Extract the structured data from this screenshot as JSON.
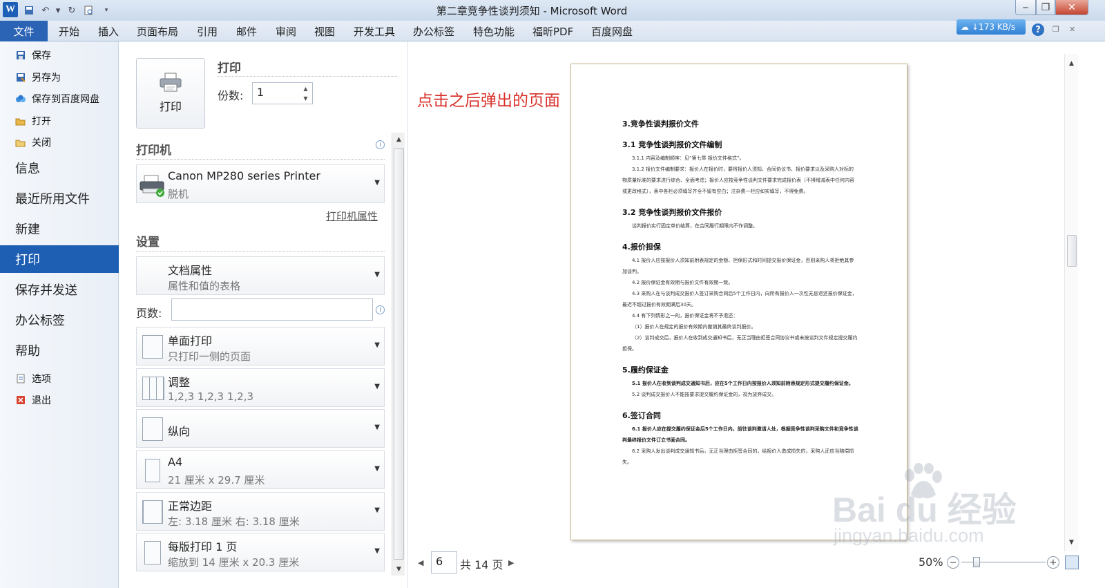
{
  "window": {
    "title": "第二章竞争性谈判须知 - Microsoft Word",
    "app_letter": "W"
  },
  "ribbon": {
    "file_tab": "文件",
    "tabs": [
      "开始",
      "插入",
      "页面布局",
      "引用",
      "邮件",
      "审阅",
      "视图",
      "开发工具",
      "办公标签",
      "特色功能",
      "福昕PDF",
      "百度网盘"
    ],
    "cloud_speed": "↓173 KB/s"
  },
  "nav": {
    "small_top": [
      {
        "label": "保存",
        "icon": "save-icon"
      },
      {
        "label": "另存为",
        "icon": "save-as-icon"
      },
      {
        "label": "保存到百度网盘",
        "icon": "baidu-cloud-icon"
      },
      {
        "label": "打开",
        "icon": "open-folder-icon"
      },
      {
        "label": "关闭",
        "icon": "close-folder-icon"
      }
    ],
    "big": [
      "信息",
      "最近所用文件",
      "新建",
      "打印",
      "保存并发送",
      "办公标签",
      "帮助"
    ],
    "small_bottom": [
      {
        "label": "选项",
        "icon": "options-icon"
      },
      {
        "label": "退出",
        "icon": "exit-icon"
      }
    ]
  },
  "print": {
    "button_label": "打印",
    "heading": "打印",
    "copies_label": "份数:",
    "copies_value": "1",
    "printer_section": "打印机",
    "printer_name": "Canon MP280 series Printer",
    "printer_status": "脱机",
    "printer_props_link": "打印机属性",
    "settings_section": "设置",
    "doc_props_title": "文档属性",
    "doc_props_sub": "属性和值的表格",
    "pages_label": "页数:",
    "pages_value": "",
    "options": [
      {
        "title": "单面打印",
        "sub": "只打印一侧的页面"
      },
      {
        "title": "调整",
        "sub": "1,2,3    1,2,3    1,2,3"
      },
      {
        "title": "纵向",
        "sub": ""
      },
      {
        "title": "A4",
        "sub": "21 厘米 x 29.7 厘米"
      },
      {
        "title": "正常边距",
        "sub": "左:  3.18 厘米    右:  3.18 厘米"
      },
      {
        "title": "每版打印 1 页",
        "sub": "缩放到 14 厘米 x 20.3 厘米"
      }
    ]
  },
  "annotation": "点击之后弹出的页面",
  "document": {
    "blocks": [
      {
        "type": "h",
        "text": "3.竞争性谈判报价文件"
      },
      {
        "type": "h",
        "text": "3.1 竞争性谈判报价文件编制"
      },
      {
        "type": "p",
        "text": "3.1.1  内容及编制顺序：见“第七章 报价文件格式”。"
      },
      {
        "type": "p",
        "text": "3.1.2  报价文件编制要求：报价人在报价时，要将报价人须知、合同协议书、报价要求以及采购人对标的物质量标准的要求进行综合、全面考虑；报价人应按竞争性谈判文件要求完成报价表（不得增减表中任何内容或更改格式），表中各栏必须填写齐全不留有空白；注杂费一栏应如实填写，不得免费。"
      },
      {
        "type": "h",
        "text": "3.2 竞争性谈判报价文件报价"
      },
      {
        "type": "p",
        "text": "谈判报价实行固定单价结算，在合同履行期限内不作调整。"
      },
      {
        "type": "h",
        "text": "4.报价担保"
      },
      {
        "type": "p",
        "text": "4.1 报价人应按报价人须知前附表规定的金额、担保形式和时间提交报价保证金，否则采购人将拒绝其参加谈判。"
      },
      {
        "type": "p",
        "text": "4.2 报价保证金有效期与报价文件有效期一致。"
      },
      {
        "type": "p",
        "text": "4.3 采购人在与谈判成交报价人签订采购合同后5个工作日内，向所有报价人一次性无息退还报价保证金，最迟不超过报价有效期满后30天。"
      },
      {
        "type": "p",
        "text": "4.4 有下列情形之一的，报价保证金将不予退还："
      },
      {
        "type": "p",
        "text": "（1）报价人在规定的报价有效期内撤销其最终谈判报价。"
      },
      {
        "type": "p",
        "text": "（2）谈判成交后，报价人在收到成交通知书后，无正当理由拒签合同协议书或未按谈判文件规定提交履约担保。"
      },
      {
        "type": "h",
        "text": "5.履约保证金"
      },
      {
        "type": "pb",
        "text": "5.1 报价人在收到谈判成交通知书后，应在5个工作日内按报价人须知前附表规定形式提交履约保证金。"
      },
      {
        "type": "p",
        "text": "5.2 谈判成交报价人不能按要求提交履约保证金的，视为放弃成交。"
      },
      {
        "type": "h",
        "text": "6.签订合同"
      },
      {
        "type": "pb",
        "text": "6.1 报价人应在提交履约保证金后5个工作日内，前往谈判邀请人处，根据竞争性谈判采购文件和竞争性谈判最终报价文件订立书面合同。"
      },
      {
        "type": "p",
        "text": "6.2 采购人发出谈判成交通知书后，无正当理由拒签合同的，给报价人造成损失的，采购人还应当赔偿损失。"
      }
    ]
  },
  "pager": {
    "current": "6",
    "total_text": "共 14 页"
  },
  "zoom": {
    "level": "50%",
    "fraction": 0.18
  },
  "watermark": {
    "logo": "Bai du 经验",
    "url": "jingyan.baidu.com"
  }
}
